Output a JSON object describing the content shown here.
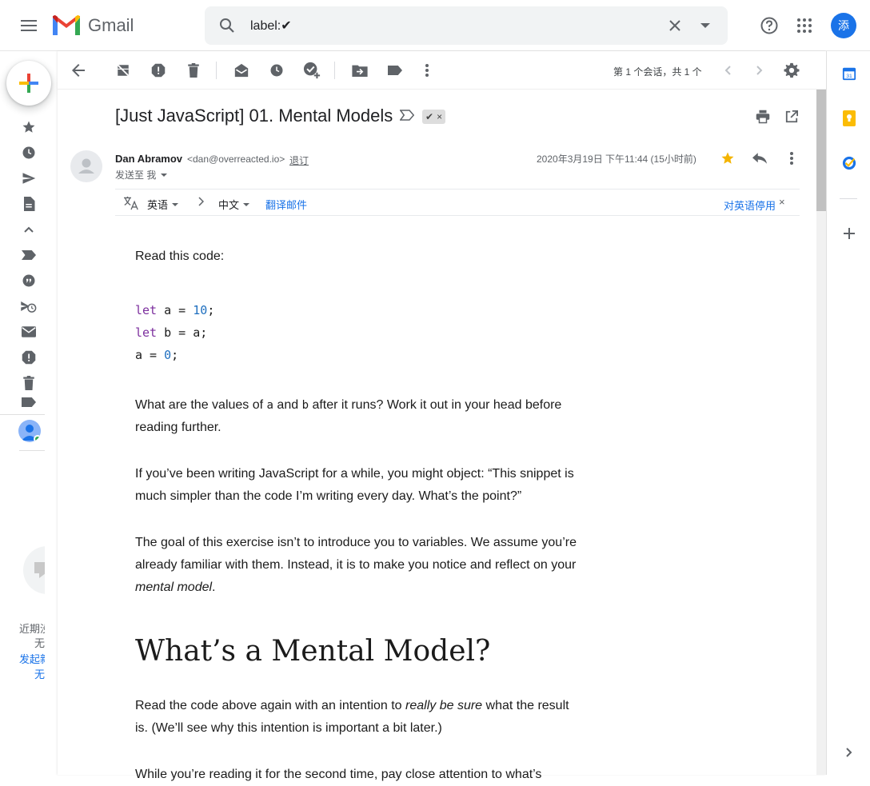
{
  "header": {
    "app_name": "Gmail",
    "search_value": "label:✔",
    "account_initial": "添"
  },
  "rail": {
    "chat_text_1": "近期没",
    "chat_text_2": "无",
    "chat_link_1": "发起新",
    "chat_link_2": "无"
  },
  "toolbar": {
    "count_text": "第 1 个会话，共 1 个"
  },
  "email": {
    "subject": "[Just JavaScript] 01. Mental Models",
    "label_chip": "✔",
    "sender_name": "Dan Abramov",
    "sender_email": "<dan@overreacted.io>",
    "unsubscribe": "退订",
    "to_text": "发送至 我",
    "date": "2020年3月19日 下午11:44 (15小时前)"
  },
  "translate": {
    "from_lang": "英语",
    "to_lang": "中文",
    "translate_link": "翻译邮件",
    "turn_off": "对英语停用",
    "close": "×"
  },
  "body": {
    "p1": "Read this code:",
    "code": [
      {
        "kw": "let",
        "rest1": " a = ",
        "num": "10",
        "rest2": ";"
      },
      {
        "kw": "let",
        "rest1": " b = a;",
        "num": "",
        "rest2": ""
      },
      {
        "kw": "",
        "rest1": "a = ",
        "num": "0",
        "rest2": ";"
      }
    ],
    "p2_a": "What are the values of ",
    "p2_code_a": "a",
    "p2_and": " and ",
    "p2_code_b": "b",
    "p2_b": " after it runs? Work it out in your head before reading further.",
    "p3": "If you’ve been writing JavaScript for a while, you might object: “This snippet is much simpler than the code I’m writing every day. What’s the point?”",
    "p4_a": "The goal of this exercise isn’t to introduce you to variables. We assume you’re already familiar with them. Instead, it is to make you notice and reflect on your ",
    "p4_em": "mental model",
    "p4_b": ".",
    "h2": "What’s a Mental Model?",
    "p5_a": "Read the code above again with an intention to ",
    "p5_em": "really be sure",
    "p5_b": " what the result is. (We’ll see why this intention is important a bit later.)",
    "p6": "While you’re reading it for the second time, pay close attention to what’s"
  },
  "colors": {
    "accent": "#1a73e8",
    "keyword": "#7c2f9e",
    "number": "#1f6fbf",
    "star": "#f4b400"
  }
}
